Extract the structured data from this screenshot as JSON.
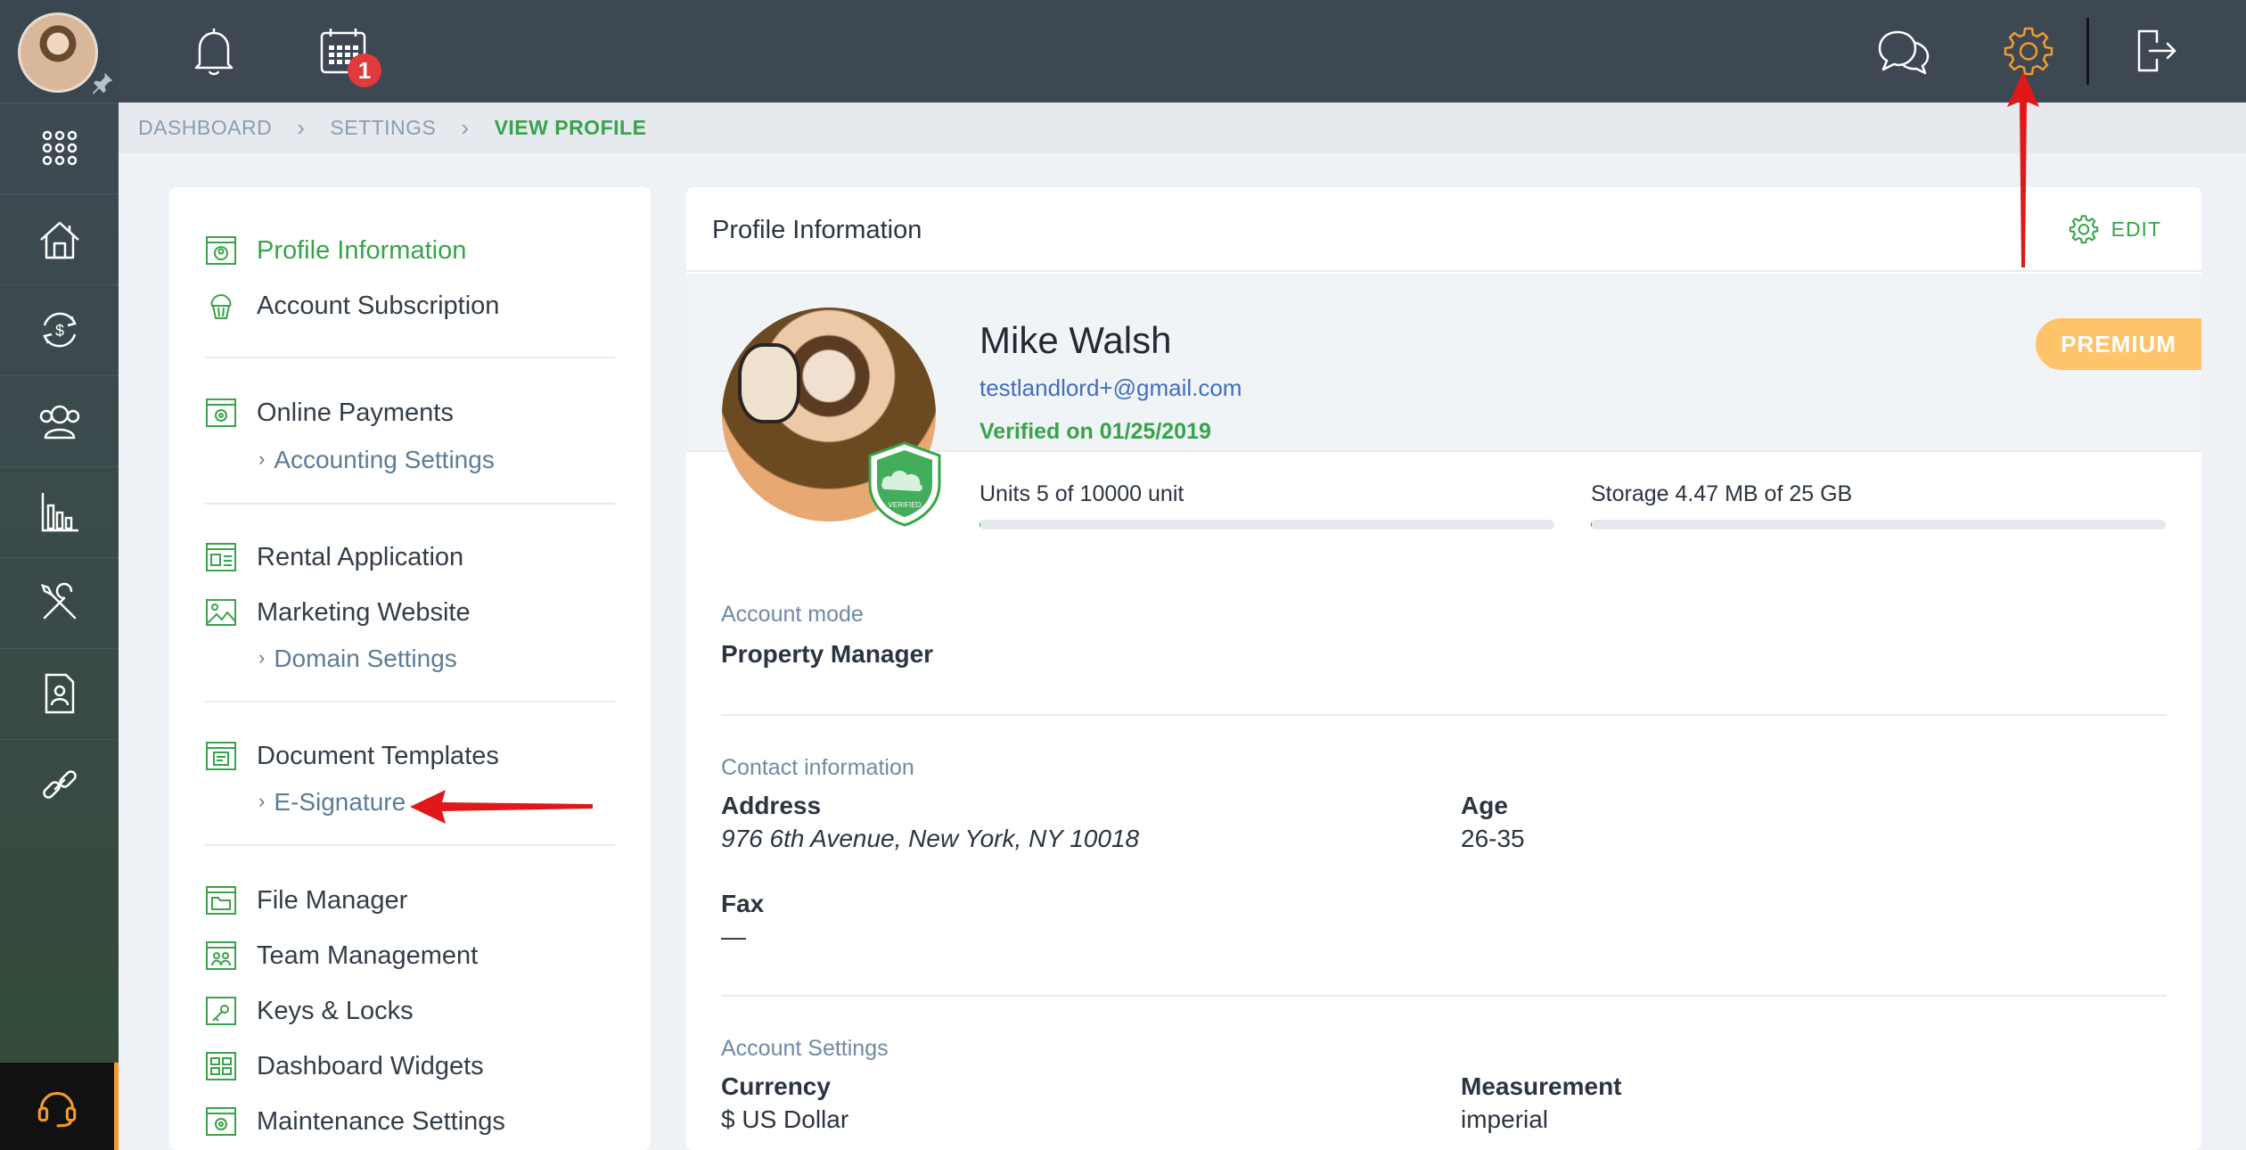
{
  "topbar": {
    "calendar_badge": "1"
  },
  "breadcrumb": {
    "items": [
      "DASHBOARD",
      "SETTINGS",
      "VIEW PROFILE"
    ]
  },
  "settings_menu": {
    "profile_information": "Profile Information",
    "account_subscription": "Account Subscription",
    "online_payments": "Online Payments",
    "accounting_settings": "Accounting Settings",
    "rental_application": "Rental Application",
    "marketing_website": "Marketing Website",
    "domain_settings": "Domain Settings",
    "document_templates": "Document Templates",
    "e_signature": "E-Signature",
    "file_manager": "File Manager",
    "team_management": "Team Management",
    "keys_locks": "Keys & Locks",
    "dashboard_widgets": "Dashboard Widgets",
    "maintenance_settings": "Maintenance Settings"
  },
  "profile": {
    "header_title": "Profile Information",
    "edit_label": "EDIT",
    "name": "Mike Walsh",
    "email": "testlandlord+@gmail.com",
    "verified": "Verified on 01/25/2019",
    "badge_text": "VERIFIED",
    "plan": "PREMIUM",
    "units_label": "Units 5 of 10000 unit",
    "units_used_fraction": 0.0005,
    "storage_label": "Storage 4.47 MB of 25 GB",
    "storage_used_fraction": 0.0002
  },
  "account_mode": {
    "section": "Account mode",
    "value": "Property Manager"
  },
  "contact": {
    "section": "Contact information",
    "address_label": "Address",
    "address_value": "976 6th Avenue, New York, NY 10018",
    "age_label": "Age",
    "age_value": "26-35",
    "fax_label": "Fax",
    "fax_value": "—"
  },
  "account_settings": {
    "section": "Account Settings",
    "currency_label": "Currency",
    "currency_value": "$ US Dollar",
    "measurement_label": "Measurement",
    "measurement_value": "imperial"
  },
  "colors": {
    "accent_green": "#38a34a",
    "premium": "#ffc36a",
    "settings_icon": "#f39a2a",
    "annotation_red": "#e01818"
  }
}
